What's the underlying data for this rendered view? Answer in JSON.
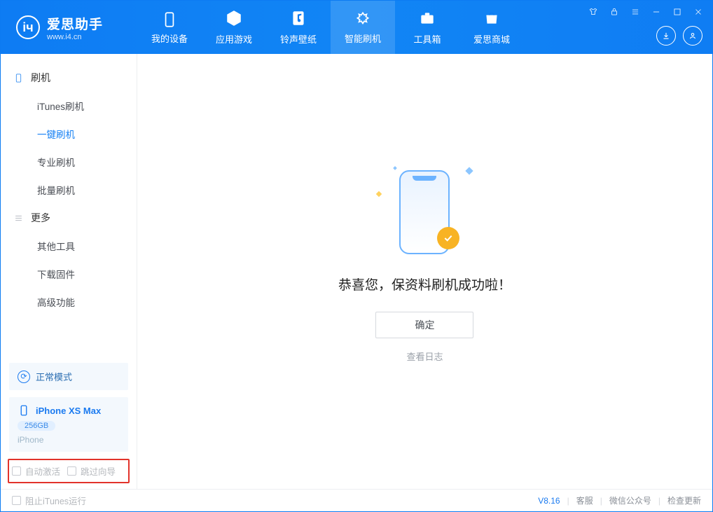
{
  "app": {
    "name": "爱思助手",
    "url": "www.i4.cn"
  },
  "tabs": {
    "device": "我的设备",
    "apps": "应用游戏",
    "ring": "铃声壁纸",
    "flash": "智能刷机",
    "toolbox": "工具箱",
    "store": "爱思商城"
  },
  "sidebar": {
    "group_flash": "刷机",
    "items_flash": {
      "itunes": "iTunes刷机",
      "oneclick": "一键刷机",
      "pro": "专业刷机",
      "batch": "批量刷机"
    },
    "group_more": "更多",
    "items_more": {
      "other": "其他工具",
      "firmware": "下载固件",
      "advanced": "高级功能"
    }
  },
  "device_card": {
    "mode": "正常模式",
    "name": "iPhone XS Max",
    "capacity": "256GB",
    "subtype": "iPhone"
  },
  "options": {
    "auto_activate": "自动激活",
    "skip_guide": "跳过向导"
  },
  "main": {
    "success": "恭喜您，保资料刷机成功啦！",
    "ok": "确定",
    "view_log": "查看日志"
  },
  "status": {
    "stop_itunes": "阻止iTunes运行",
    "version": "V8.16",
    "support": "客服",
    "wechat": "微信公众号",
    "update": "检查更新"
  }
}
